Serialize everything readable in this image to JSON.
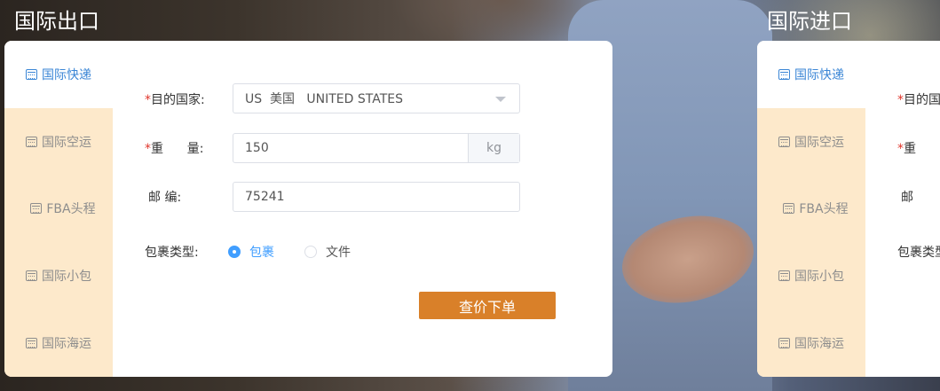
{
  "export": {
    "title": "国际出口",
    "tabs": [
      {
        "label": "国际快递",
        "icon": "calendar-icon",
        "active": true
      },
      {
        "label": "国际空运",
        "icon": "calendar-icon",
        "active": false
      },
      {
        "label": "FBA头程",
        "icon": "calendar-icon",
        "active": false
      },
      {
        "label": "国际小包",
        "icon": "calendar-icon",
        "active": false
      },
      {
        "label": "国际海运",
        "icon": "calendar-icon",
        "active": false
      }
    ],
    "form": {
      "required_mark": "*",
      "country_label": "目的国家:",
      "country_value": "US  美国   UNITED STATES",
      "weight_label": "重      量:",
      "weight_value": "150",
      "weight_unit": "kg",
      "postcode_label": "邮      编:",
      "postcode_value": "75241",
      "package_type_label": "包裹类型:",
      "package_type_options": [
        "包裹",
        "文件"
      ],
      "package_type_selected": "包裹",
      "submit_label": "查价下单"
    }
  },
  "import": {
    "title": "国际进口",
    "tabs": [
      {
        "label": "国际快递",
        "icon": "calendar-icon",
        "active": true
      },
      {
        "label": "国际空运",
        "icon": "calendar-icon",
        "active": false
      },
      {
        "label": "FBA头程",
        "icon": "calendar-icon",
        "active": false
      },
      {
        "label": "国际小包",
        "icon": "calendar-icon",
        "active": false
      },
      {
        "label": "国际海运",
        "icon": "calendar-icon",
        "active": false
      }
    ],
    "form": {
      "required_mark": "*",
      "country_label": "目的国",
      "weight_label": "重",
      "postcode_label": "邮",
      "package_type_label": "包裹类型"
    }
  },
  "colors": {
    "accent_blue": "#3b86d6",
    "tab_background": "#fde9cb",
    "submit_orange": "#d98029",
    "required_red": "#e0352b"
  }
}
